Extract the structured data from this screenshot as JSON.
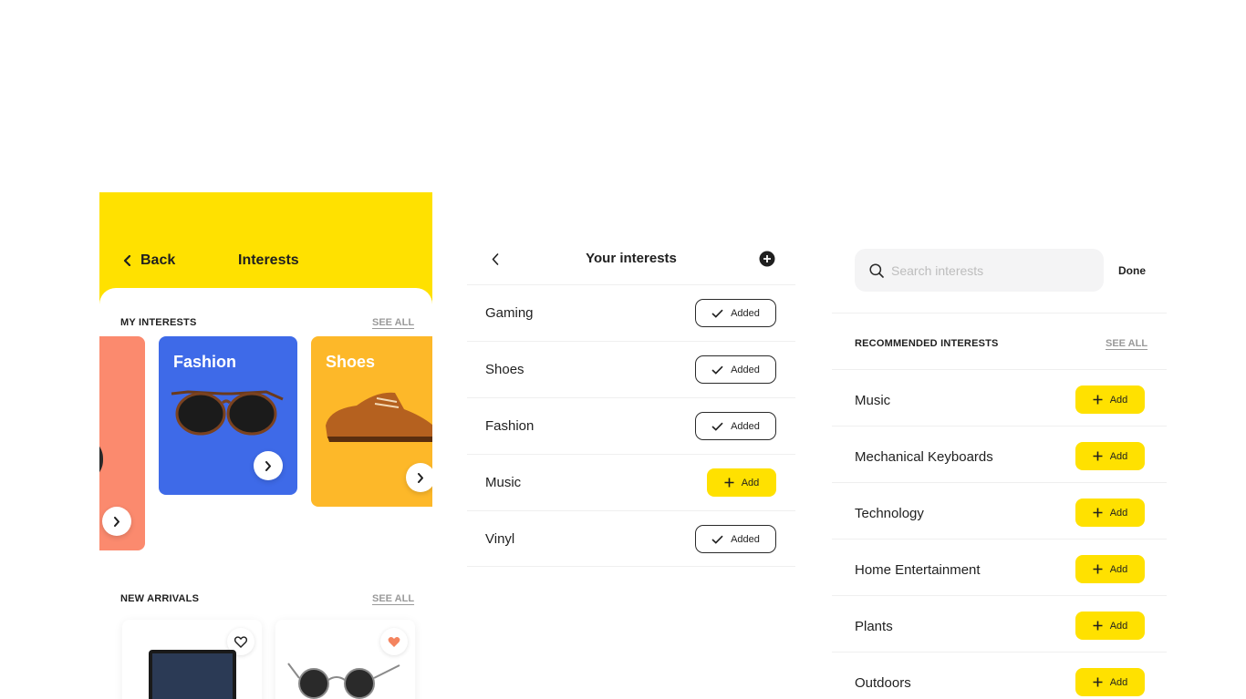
{
  "panel1": {
    "back_label": "Back",
    "title": "Interests",
    "my_interests_label": "MY INTERESTS",
    "see_all_1": "SEE ALL",
    "cards": [
      {
        "name": "Fashion",
        "color": "#3e6ae8"
      },
      {
        "name": "Shoes",
        "color": "#fdb829"
      }
    ],
    "new_arrivals_label": "NEW ARRIVALS",
    "see_all_2": "SEE ALL"
  },
  "panel2": {
    "title": "Your interests",
    "rows": [
      {
        "label": "Gaming",
        "status": "Added"
      },
      {
        "label": "Shoes",
        "status": "Added"
      },
      {
        "label": "Fashion",
        "status": "Added"
      },
      {
        "label": "Music",
        "status": "Add"
      },
      {
        "label": "Vinyl",
        "status": "Added"
      }
    ]
  },
  "panel3": {
    "search_placeholder": "Search interests",
    "done_label": "Done",
    "recommended_label": "RECOMMENDED INTERESTS",
    "see_all": "SEE ALL",
    "add_label": "Add",
    "rows": [
      {
        "label": "Music"
      },
      {
        "label": "Mechanical Keyboards"
      },
      {
        "label": "Technology"
      },
      {
        "label": "Home Entertainment"
      },
      {
        "label": "Plants"
      },
      {
        "label": "Outdoors"
      }
    ]
  },
  "colors": {
    "accent": "#ffe100",
    "coral": "#fb8a6e",
    "heart_active": "#f4845f"
  }
}
